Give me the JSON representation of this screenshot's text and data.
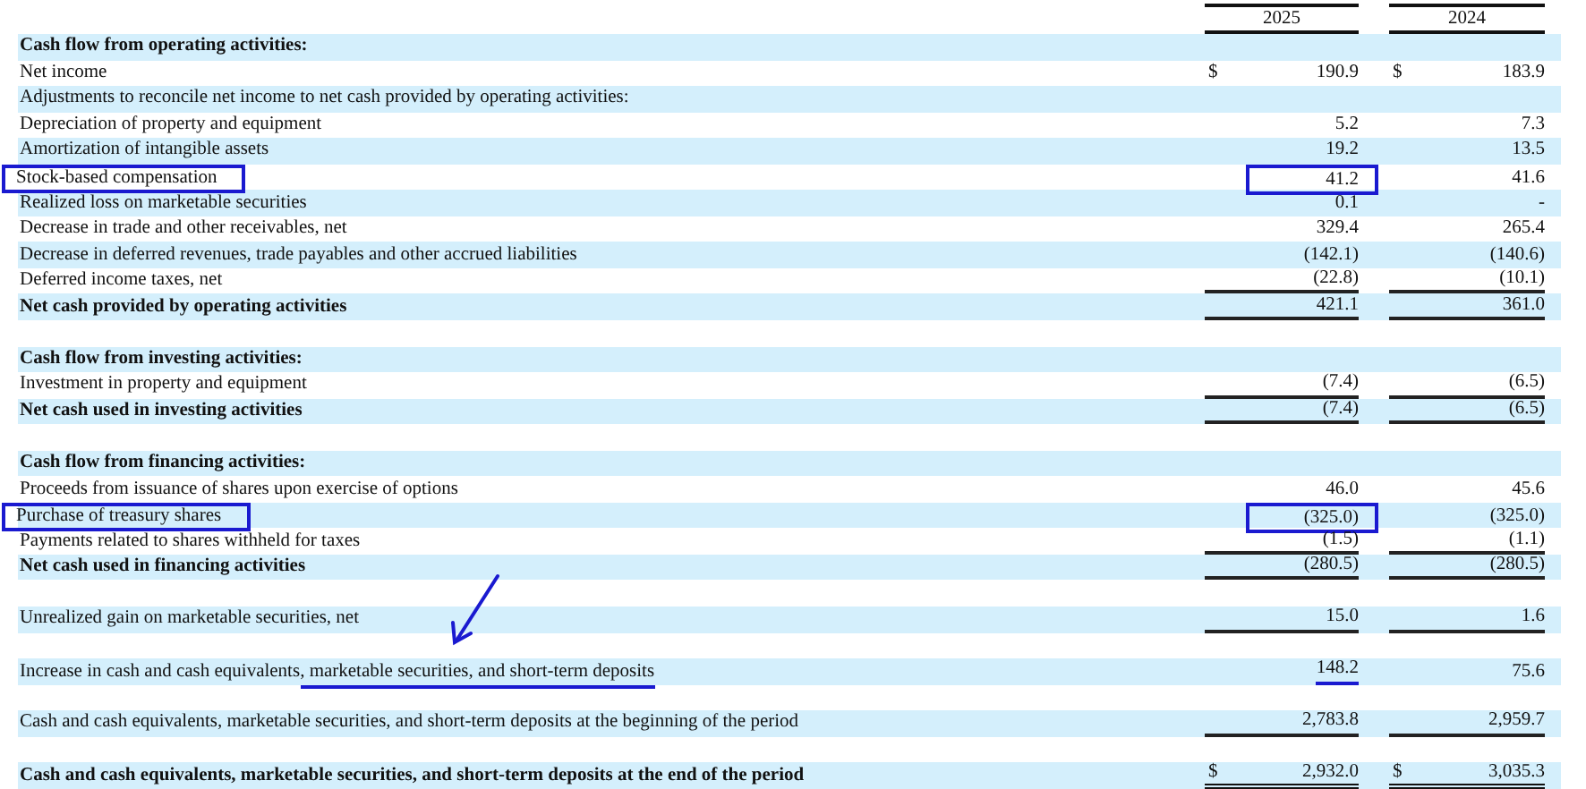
{
  "columns": [
    "2025",
    "2024"
  ],
  "rows": [
    {
      "kind": "heading",
      "label": "Cash flow from operating activities:"
    },
    {
      "kind": "item",
      "label": "Net income",
      "values": [
        {
          "currency": "$",
          "text": "190.9"
        },
        {
          "currency": "$",
          "text": "183.9"
        }
      ]
    },
    {
      "kind": "item",
      "label": "Adjustments to reconcile net income to net cash provided by operating activities:"
    },
    {
      "kind": "item",
      "label": "Depreciation of property and equipment",
      "values": [
        {
          "text": "5.2"
        },
        {
          "text": "7.3"
        }
      ]
    },
    {
      "kind": "item",
      "label": "Amortization of intangible assets",
      "values": [
        {
          "text": "19.2"
        },
        {
          "text": "13.5"
        }
      ]
    },
    {
      "kind": "item",
      "label": "Stock-based compensation",
      "boxed": true,
      "values": [
        {
          "text": "41.2",
          "boxed": true
        },
        {
          "text": "41.6"
        }
      ]
    },
    {
      "kind": "item",
      "label": "Realized loss on marketable securities",
      "values": [
        {
          "text": "0.1"
        },
        {
          "text": "-"
        }
      ]
    },
    {
      "kind": "item",
      "label": "Decrease in trade and other receivables, net",
      "values": [
        {
          "text": "329.4"
        },
        {
          "text": "265.4"
        }
      ]
    },
    {
      "kind": "item",
      "label": "Decrease in deferred revenues, trade payables and other accrued liabilities",
      "values": [
        {
          "text": "(142.1)"
        },
        {
          "text": "(140.6)"
        }
      ]
    },
    {
      "kind": "item",
      "label": "Deferred income taxes, net",
      "values": [
        {
          "text": "(22.8)",
          "ruled": true
        },
        {
          "text": "(10.1)",
          "ruled": true
        }
      ]
    },
    {
      "kind": "total",
      "label": "Net cash provided by operating activities",
      "values": [
        {
          "text": "421.1",
          "ruled": true
        },
        {
          "text": "361.0",
          "ruled": true
        }
      ]
    },
    {
      "kind": "spacer"
    },
    {
      "kind": "heading",
      "label": "Cash flow from investing activities:"
    },
    {
      "kind": "item",
      "label": "Investment in property and equipment",
      "values": [
        {
          "text": "(7.4)",
          "ruled": true
        },
        {
          "text": "(6.5)",
          "ruled": true
        }
      ]
    },
    {
      "kind": "total",
      "label": "Net cash used in investing activities",
      "values": [
        {
          "text": "(7.4)",
          "ruled": true
        },
        {
          "text": "(6.5)",
          "ruled": true
        }
      ]
    },
    {
      "kind": "spacer"
    },
    {
      "kind": "heading",
      "label": "Cash flow from financing activities:"
    },
    {
      "kind": "item",
      "label": "Proceeds from issuance of shares upon exercise of options",
      "values": [
        {
          "text": "46.0"
        },
        {
          "text": "45.6"
        }
      ]
    },
    {
      "kind": "item",
      "label": "Purchase of treasury shares",
      "boxed": true,
      "values": [
        {
          "text": "(325.0)",
          "boxed": true
        },
        {
          "text": "(325.0)"
        }
      ]
    },
    {
      "kind": "item",
      "label": "Payments related to shares withheld for taxes",
      "values": [
        {
          "text": "(1.5)",
          "ruled": true
        },
        {
          "text": "(1.1)",
          "ruled": true
        }
      ]
    },
    {
      "kind": "total",
      "label": "Net cash used in financing activities",
      "values": [
        {
          "text": "(280.5)",
          "ruled": true
        },
        {
          "text": "(280.5)",
          "ruled": true
        }
      ]
    },
    {
      "kind": "spacer"
    },
    {
      "kind": "item",
      "label": "Unrealized gain on marketable securities, net",
      "values": [
        {
          "text": "15.0",
          "ruled": true
        },
        {
          "text": "1.6",
          "ruled": true
        }
      ]
    },
    {
      "kind": "spacer",
      "arrow": true
    },
    {
      "kind": "item",
      "label": "Increase in cash and cash equivalents",
      "marked_part": ", marketable securities, and short-term deposits",
      "values": [
        {
          "text": "148.2",
          "underlined": true
        },
        {
          "text": "75.6"
        }
      ]
    },
    {
      "kind": "spacer"
    },
    {
      "kind": "item",
      "label": "Cash and cash equivalents, marketable securities, and short-term deposits at the beginning of the period",
      "values": [
        {
          "text": "2,783.8",
          "ruled": true
        },
        {
          "text": "2,959.7",
          "ruled": true
        }
      ]
    },
    {
      "kind": "spacer"
    },
    {
      "kind": "total",
      "label": "Cash and cash equivalents, marketable securities, and short-term deposits at the end of the period",
      "values": [
        {
          "currency": "$",
          "text": "2,932.0",
          "double_ruled": true
        },
        {
          "currency": "$",
          "text": "3,035.3",
          "double_ruled": true
        }
      ]
    }
  ]
}
